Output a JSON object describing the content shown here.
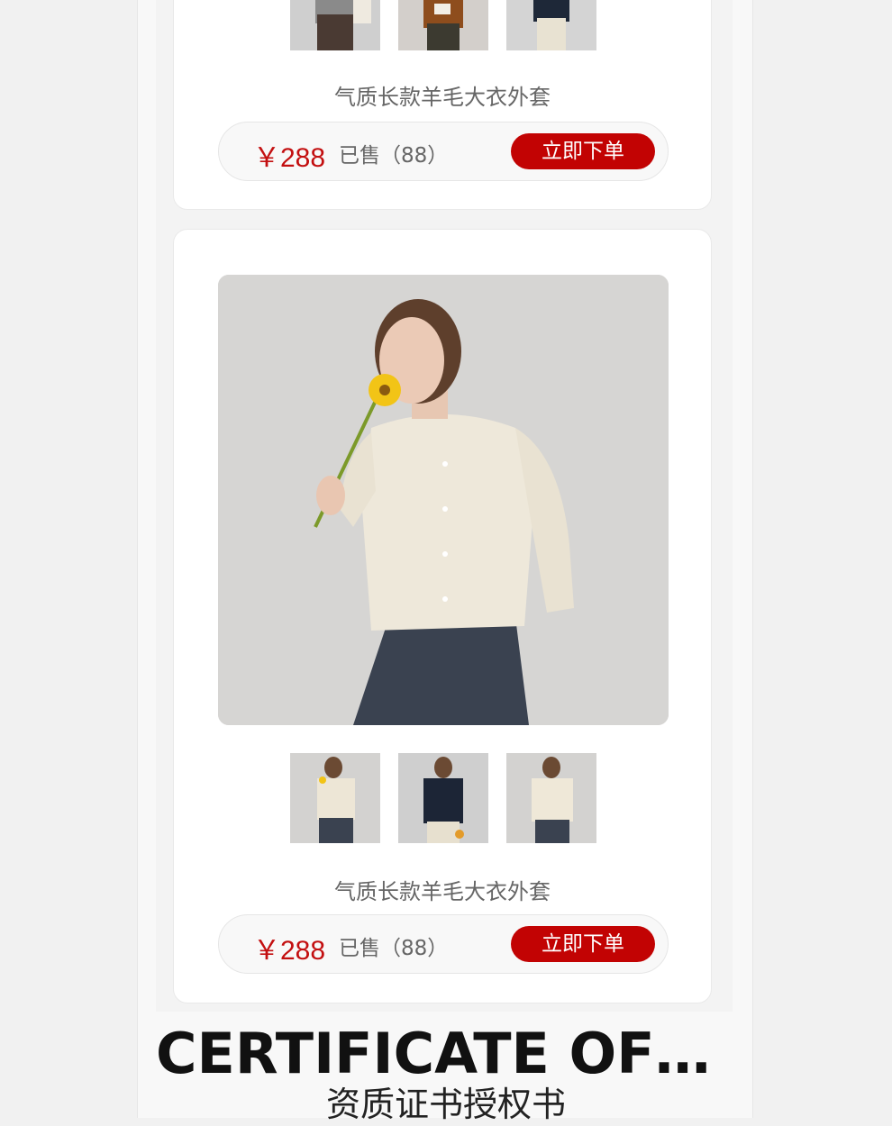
{
  "products": [
    {
      "title": "气质长款羊毛大衣外套",
      "price": "￥288",
      "sold": "已售（88）",
      "buy_label": "立即下单",
      "thumbnails": [
        "thumb-grey-sweater-icon",
        "thumb-brown-coat-icon",
        "thumb-navy-cardigan-icon"
      ]
    },
    {
      "title": "气质长款羊毛大衣外套",
      "price": "￥288",
      "sold": "已售（88）",
      "buy_label": "立即下单",
      "thumbnails": [
        "thumb-cream-cardigan-flower-icon",
        "thumb-navy-cardigan-icon",
        "thumb-cream-cardigan-icon"
      ]
    }
  ],
  "certificate": {
    "title": "CERTIFICATE OF H...",
    "subtitle": "资质证书授权书"
  },
  "colors": {
    "accent": "#c20303",
    "price": "#c30f10"
  }
}
